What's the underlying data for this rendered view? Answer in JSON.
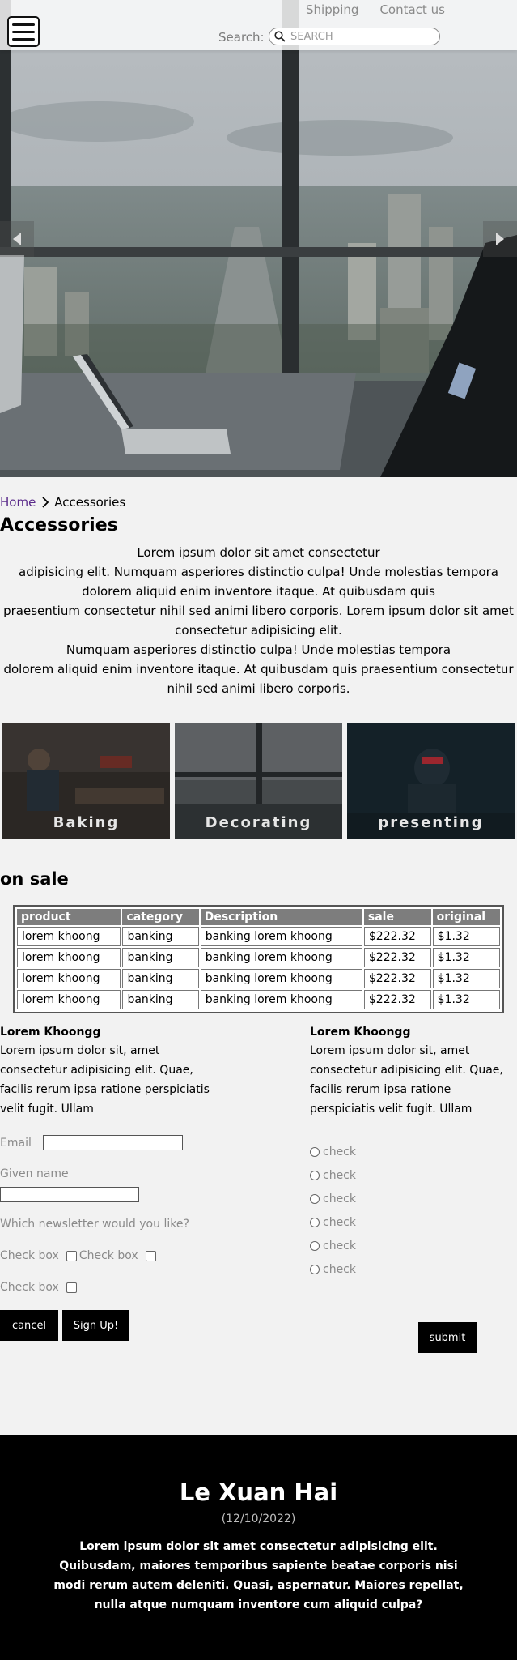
{
  "header": {
    "nav": [
      "Shipping",
      "Contact us"
    ],
    "search_label": "Search:",
    "search_placeholder": "SEARCH"
  },
  "icons": {
    "menu": "hamburger-icon",
    "search": "search-icon",
    "prev": "triangle-left-icon",
    "next": "triangle-right-icon",
    "breadcrumb_sep": "chevron-right-icon"
  },
  "breadcrumb": {
    "home": "Home",
    "current": "Accessories"
  },
  "page": {
    "title": "Accessories",
    "intro_lines": [
      "Lorem ipsum dolor sit amet consectetur",
      "adipisicing elit. Numquam asperiores distinctio culpa! Unde molestias tempora dolorem aliquid enim inventore itaque. At quibusdam quis",
      "praesentium consectetur nihil sed animi libero corporis. Lorem ipsum dolor sit amet consectetur adipisicing elit.",
      "Numquam asperiores distinctio culpa! Unde molestias tempora",
      "dolorem aliquid enim inventore itaque. At quibusdam quis praesentium consectetur nihil sed animi libero corporis."
    ]
  },
  "categories": [
    "Baking",
    "Decorating",
    "presenting"
  ],
  "sale": {
    "title": "on sale",
    "columns": [
      "product",
      "category",
      "Description",
      "sale",
      "original"
    ],
    "rows": [
      [
        "lorem khoong",
        "banking",
        "banking lorem khoong",
        "$222.32",
        "$1.32"
      ],
      [
        "lorem khoong",
        "banking",
        "banking lorem khoong",
        "$222.32",
        "$1.32"
      ],
      [
        "lorem khoong",
        "banking",
        "banking lorem khoong",
        "$222.32",
        "$1.32"
      ],
      [
        "lorem khoong",
        "banking",
        "banking lorem khoong",
        "$222.32",
        "$1.32"
      ]
    ]
  },
  "left_column": {
    "title": "Lorem Khoongg",
    "text": "Lorem ipsum dolor sit, amet consectetur adipisicing elit. Quae, facilis rerum ipsa ratione perspiciatis velit fugit. Ullam"
  },
  "right_column": {
    "title": "Lorem Khoongg",
    "text": "Lorem ipsum dolor sit, amet consectetur adipisicing elit. Quae, facilis rerum ipsa ratione perspiciatis velit fugit. Ullam"
  },
  "form": {
    "email_label": "Email",
    "given_name_label": "Given name",
    "newsletter_question": "Which newsletter would you like?",
    "checkbox_label": "Check box",
    "cancel": "cancel",
    "signup": "Sign Up!",
    "submit": "submit"
  },
  "radios": [
    "check",
    "check",
    "check",
    "check",
    "check",
    "check"
  ],
  "footer": {
    "name": "Le Xuan Hai",
    "date": "(12/10/2022)",
    "text": "Lorem ipsum dolor sit amet consectetur adipisicing elit. Quibusdam, maiores temporibus sapiente beatae corporis nisi modi rerum autem deleniti. Quasi, aspernatur. Maiores repellat, nulla atque numquam inventore cum aliquid culpa?"
  }
}
